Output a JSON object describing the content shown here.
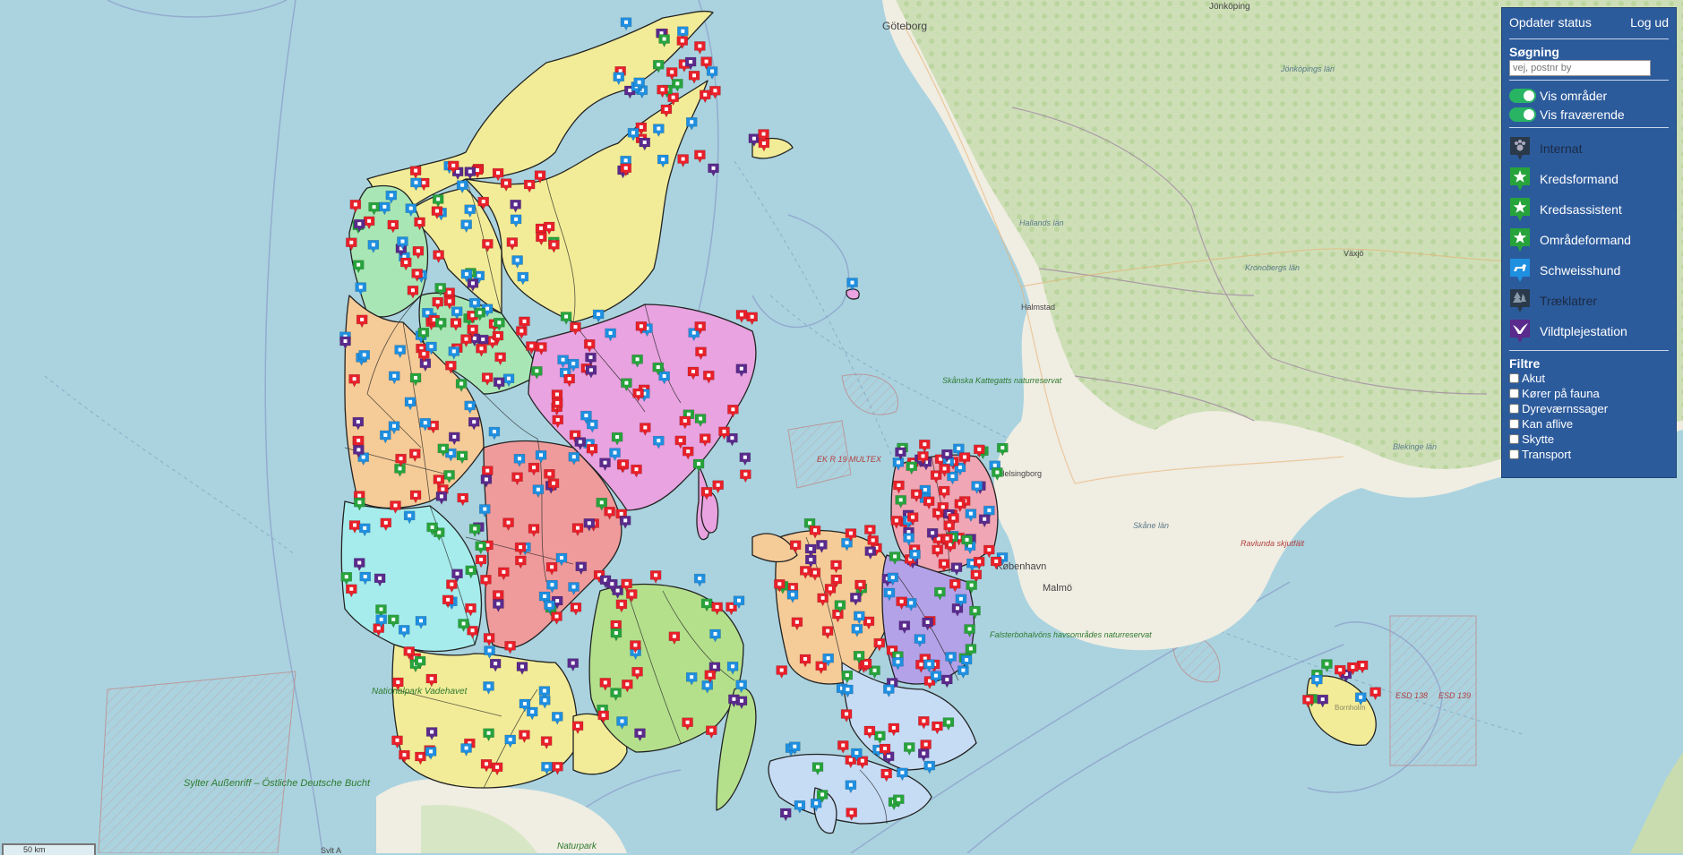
{
  "panel": {
    "update_status": "Opdater status",
    "logout": "Log ud",
    "search_title": "Søgning",
    "search_placeholder": "vej, postnr by",
    "search_value": "",
    "toggles": [
      {
        "label": "Vis områder",
        "on": true
      },
      {
        "label": "Vis fraværende",
        "on": true
      }
    ],
    "legend": [
      {
        "label": "Internat",
        "icon": "paw-icon",
        "color": "#2b3a4a",
        "dim": true
      },
      {
        "label": "Kredsformand",
        "icon": "star-icon",
        "color": "#27a33c",
        "dim": false
      },
      {
        "label": "Kredsassistent",
        "icon": "star-icon",
        "color": "#27a33c",
        "dim": false
      },
      {
        "label": "Områdeformand",
        "icon": "star-icon",
        "color": "#27a33c",
        "dim": false
      },
      {
        "label": "Schweisshund",
        "icon": "dog-icon",
        "color": "#1f8fe0",
        "dim": false
      },
      {
        "label": "Træklatrer",
        "icon": "tree-icon",
        "color": "#2b3a4a",
        "dim": true
      },
      {
        "label": "Vildtplejestation",
        "icon": "bird-icon",
        "color": "#5a2a8c",
        "dim": false
      }
    ],
    "filter_title": "Filtre",
    "filters": [
      "Akut",
      "Kører på fauna",
      "Dyreværnssager",
      "Kan aflive",
      "Skytte",
      "Transport"
    ]
  },
  "map_labels": {
    "goteborg": "Göteborg",
    "jonkoping": "Jönköping",
    "jonkoping_lan": "Jönköpings län",
    "hallands_lan": "Hallands län",
    "kronobergs_lan": "Kronobergs län",
    "vaxjo": "Växjö",
    "halmstad": "Halmstad",
    "skane_lan": "Skåne län",
    "blekinge_lan": "Blekinge län",
    "helsingborg": "Helsingborg",
    "malmo": "Malmö",
    "kobenhavn": "København",
    "skanska": "Skånska Kattegatts naturreservat",
    "falsterbo": "Falsterbohalvöns havsområdes naturreservat",
    "ravlunda": "Ravlunda skjutfält",
    "ek": "EK R 19 MULTEX",
    "esd138": "ESD 138",
    "esd139": "ESD 139",
    "sylter": "Sylter Außenriff – Östliche Deutsche Bucht",
    "nationalpark": "Nationalpark Vadehavet",
    "naturpark": "Naturpark",
    "sylt": "Sylt A",
    "bornholm": "Bornholm"
  },
  "scale": "50 km",
  "colors": {
    "panel": "#2c5b9c",
    "sea": "#aad3df",
    "land_sweden": "#eae6d6",
    "forest": "#c7dcb0",
    "marker_red": "#e8202a",
    "marker_blue": "#1f8fe0",
    "marker_green": "#27a33c",
    "marker_purple": "#5a2a8c"
  }
}
